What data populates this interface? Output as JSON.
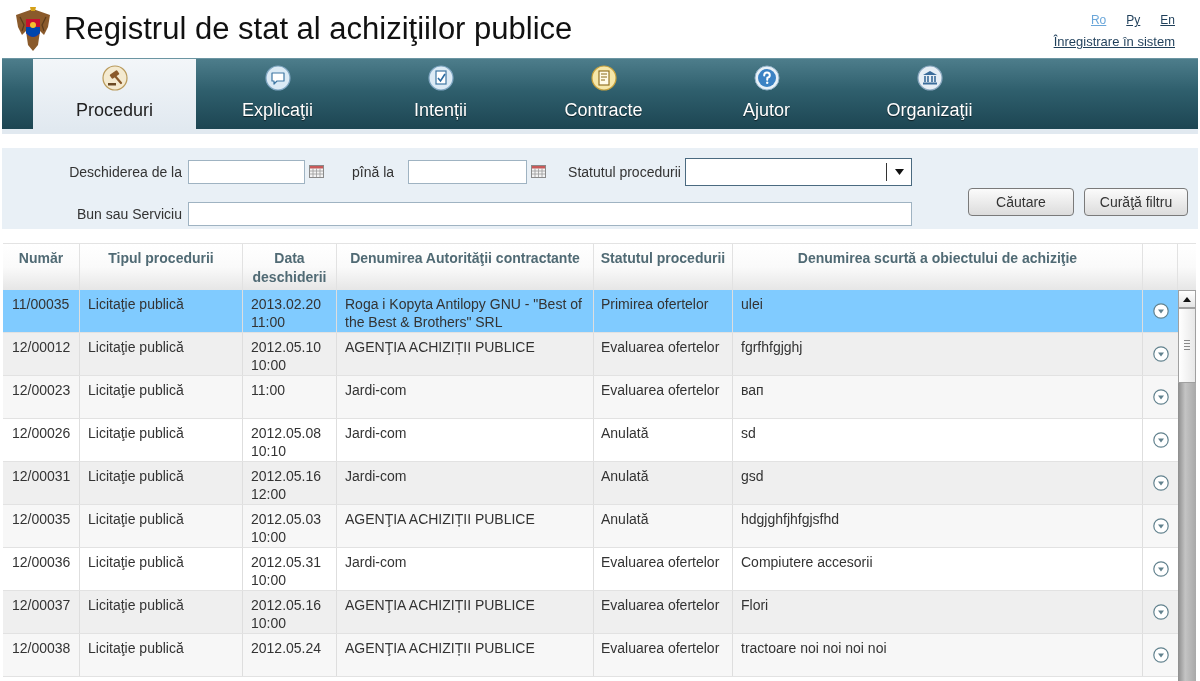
{
  "header": {
    "title": "Registrul de stat al achiziţiilor publice",
    "languages": [
      {
        "label": "Ro",
        "selected": true
      },
      {
        "label": "Ру",
        "selected": false
      },
      {
        "label": "En",
        "selected": false
      }
    ],
    "login_link": "Înregistrare în sistem"
  },
  "nav": [
    {
      "label": "Proceduri",
      "selected": true
    },
    {
      "label": "Explicaţii",
      "selected": false
    },
    {
      "label": "Intenții",
      "selected": false
    },
    {
      "label": "Contracte",
      "selected": false
    },
    {
      "label": "Ajutor",
      "selected": false
    },
    {
      "label": "Organizaţii",
      "selected": false
    }
  ],
  "filter": {
    "date_from_label": "Deschiderea de la",
    "date_to_label": "pînă la",
    "status_label": "Statutul procedurii",
    "item_label": "Bun sau Serviciu",
    "buttons": [
      "Căutare",
      "Curăţă filtru"
    ]
  },
  "table": {
    "columns": [
      "Număr",
      "Tipul procedurii",
      "Data deschiderii",
      "Denumirea Autorităţii contractante",
      "Statutul procedurii",
      "Denumirea scurtă a obiectului de achiziţie"
    ],
    "rows": [
      {
        "number": "11/00035",
        "type": "Licitaţie publică",
        "date": "2013.02.20 11:00",
        "authority": "Roga i Kopyta Antilopy GNU - \"Best of the Best & Brothers\" SRL",
        "status": "Primirea ofertelor",
        "object": "ulei",
        "selected": true
      },
      {
        "number": "12/00012",
        "type": "Licitaţie publică",
        "date": "2012.05.10 10:00",
        "authority": "AGENŢIA ACHIZIȚII PUBLICE",
        "status": "Evaluarea ofertelor",
        "object": "fgrfhfgjghj",
        "selected": false
      },
      {
        "number": "12/00023",
        "type": "Licitaţie publică",
        "date": "11:00",
        "authority": "Jardi-com",
        "status": "Evaluarea ofertelor",
        "object": "вап",
        "selected": false
      },
      {
        "number": "12/00026",
        "type": "Licitaţie publică",
        "date": "2012.05.08 10:10",
        "authority": "Jardi-com",
        "status": "Anulată",
        "object": "sd",
        "selected": false
      },
      {
        "number": "12/00031",
        "type": "Licitaţie publică",
        "date": "2012.05.16 12:00",
        "authority": "Jardi-com",
        "status": "Anulată",
        "object": "gsd",
        "selected": false
      },
      {
        "number": "12/00035",
        "type": "Licitaţie publică",
        "date": "2012.05.03 10:00",
        "authority": "AGENŢIA ACHIZIȚII PUBLICE",
        "status": "Anulată",
        "object": "hdgjghfjhfgjsfhd",
        "selected": false
      },
      {
        "number": "12/00036",
        "type": "Licitaţie publică",
        "date": "2012.05.31 10:00",
        "authority": "Jardi-com",
        "status": "Evaluarea ofertelor",
        "object": "Compiutere accesorii",
        "selected": false
      },
      {
        "number": "12/00037",
        "type": "Licitaţie publică",
        "date": "2012.05.16 10:00",
        "authority": "AGENŢIA ACHIZIȚII PUBLICE",
        "status": "Evaluarea ofertelor",
        "object": "Flori",
        "selected": false
      },
      {
        "number": "12/00038",
        "type": "Licitaţie publică",
        "date": "2012.05.24",
        "authority": "AGENŢIA ACHIZIȚII PUBLICE",
        "status": "Evaluarea ofertelor",
        "object": "tractoare noi noi noi noi",
        "selected": false
      }
    ]
  }
}
